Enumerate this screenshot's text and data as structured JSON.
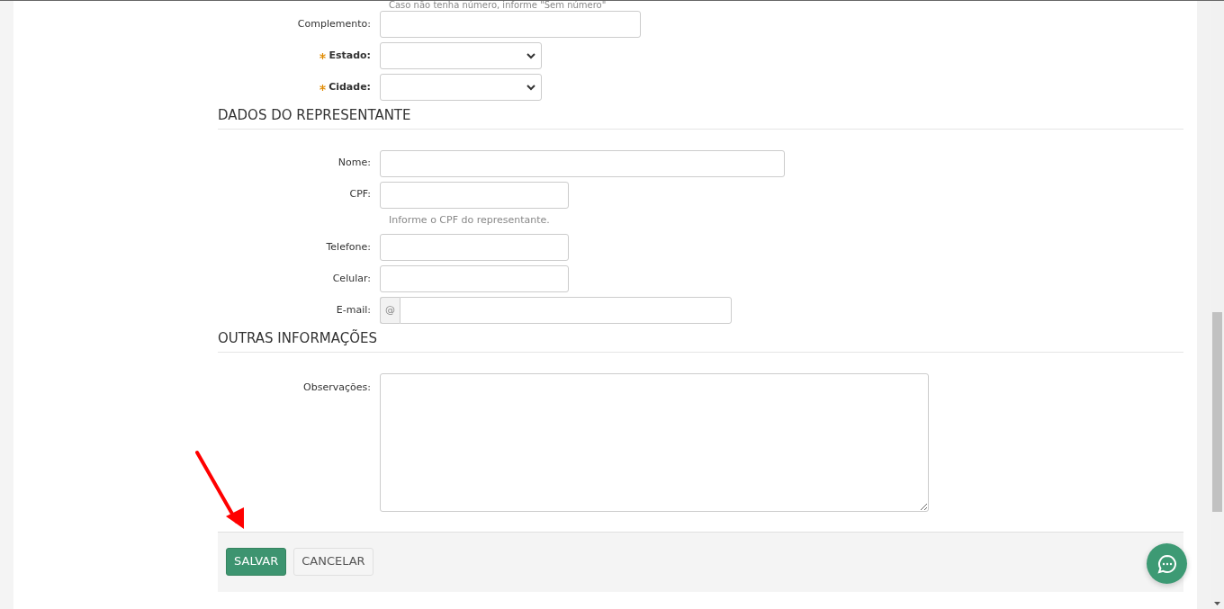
{
  "top_hint": "Caso não tenha número, informe \"Sem número\"",
  "address_fields": [
    {
      "label": "Complemento:",
      "kind": "text",
      "required": false
    },
    {
      "label": "Estado:",
      "kind": "select",
      "required": true
    },
    {
      "label": "Cidade:",
      "kind": "select",
      "required": true
    }
  ],
  "sections": [
    {
      "title": "DADOS DO REPRESENTANTE",
      "fields": [
        {
          "label": "Nome:",
          "kind": "text",
          "required": false
        },
        {
          "label": "CPF:",
          "kind": "text",
          "required": false,
          "help": "Informe o CPF do representante."
        },
        {
          "label": "Telefone:",
          "kind": "text",
          "required": false
        },
        {
          "label": "Celular:",
          "kind": "text",
          "required": false
        },
        {
          "label": "E-mail:",
          "kind": "email",
          "required": false,
          "addon": "@"
        }
      ]
    },
    {
      "title": "OUTRAS INFORMAÇÕES",
      "fields": [
        {
          "label": "Observações:",
          "kind": "textarea",
          "required": false
        }
      ]
    }
  ],
  "buttons": [
    {
      "label": "SALVAR",
      "kind": "primary"
    },
    {
      "label": "CANCELAR",
      "kind": "secondary"
    }
  ]
}
